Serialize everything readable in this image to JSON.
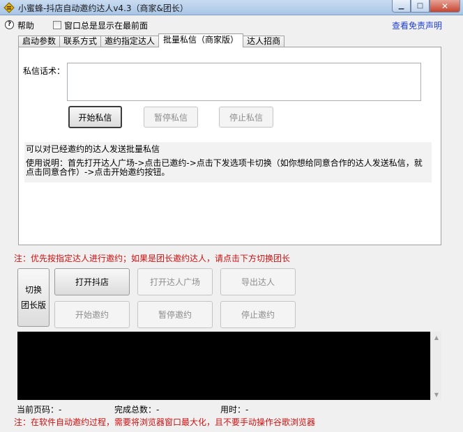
{
  "window": {
    "title": "小蜜蜂-抖店自动邀约达人v4.3（商家&团长）",
    "controls": {
      "minimize": "▁",
      "maximize": "□",
      "close": "✕"
    }
  },
  "menu": {
    "help_label": "帮助",
    "topmost_label": "窗口总是显示在最前面",
    "topmost_checked": false,
    "disclaimer_link": "查看免责声明"
  },
  "tabs": [
    {
      "label": "启动参数"
    },
    {
      "label": "联系方式"
    },
    {
      "label": "邀约指定达人"
    },
    {
      "label": "批量私信（商家版）",
      "active": true
    },
    {
      "label": "达人招商"
    }
  ],
  "panel": {
    "message_label": "私信话术：",
    "message_value": "",
    "start_button": "开始私信",
    "pause_button": "暂停私信",
    "stop_button": "停止私信",
    "info_line1": "可以对已经邀约的达人发送批量私信",
    "info_line2": "使用说明：首先打开达人广场->点击已邀约->点击下发选项卡切换（如你想给同意合作的达人发送私信，就点击同意合作）->点击开始邀约按钮。"
  },
  "notes": {
    "top": "注：优先按指定达人进行邀约；如果是团长邀约达人，请点击下方切换团长",
    "bottom": "注：在软件自动邀约过程，需要将浏览器窗口最大化，且不要手动操作谷歌浏览器"
  },
  "actions": {
    "switch_line1": "切换",
    "switch_line2": "团长版",
    "open_store": "打开抖店",
    "open_plaza": "打开达人广场",
    "export": "导出达人",
    "start_invite": "开始邀约",
    "pause_invite": "暂停邀约",
    "stop_invite": "停止邀约"
  },
  "status": {
    "current_page": "当前页码：-",
    "total_done": "完成总数：-",
    "time_used": "用时：-"
  },
  "colors": {
    "note_red": "#d01010",
    "link_blue": "#1d3ed6",
    "console_bg": "#000000"
  }
}
